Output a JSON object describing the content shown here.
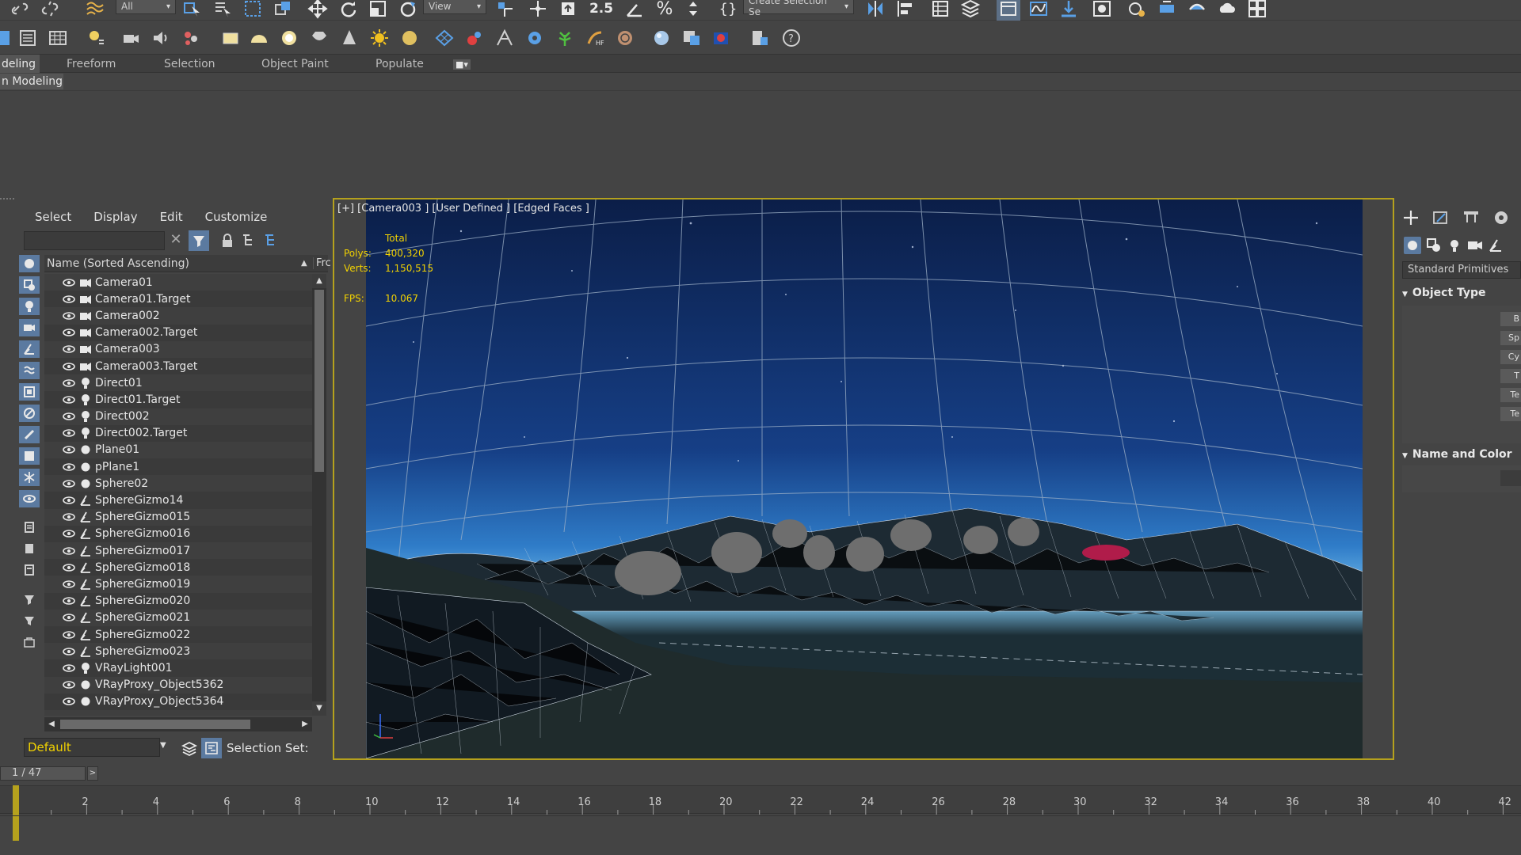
{
  "toolbar": {
    "selection_filter": "All",
    "reference_coord": "View",
    "named_selection": "Create Selection Se",
    "snap_label": "2.5"
  },
  "ribbon": {
    "tabs": [
      "deling",
      "Freeform",
      "Selection",
      "Object Paint",
      "Populate"
    ],
    "sub_label": "n Modeling"
  },
  "scene_explorer": {
    "menu": [
      "Select",
      "Display",
      "Edit",
      "Customize"
    ],
    "column_header": "Name (Sorted Ascending)",
    "column_header2": "Frc",
    "objects": [
      {
        "name": "Camera01",
        "type": "camera-icon"
      },
      {
        "name": "Camera01.Target",
        "type": "camera-icon"
      },
      {
        "name": "Camera002",
        "type": "camera-icon"
      },
      {
        "name": "Camera002.Target",
        "type": "camera-icon"
      },
      {
        "name": "Camera003",
        "type": "camera-icon"
      },
      {
        "name": "Camera003.Target",
        "type": "camera-icon"
      },
      {
        "name": "Direct01",
        "type": "light-icon"
      },
      {
        "name": "Direct01.Target",
        "type": "light-icon"
      },
      {
        "name": "Direct002",
        "type": "light-icon"
      },
      {
        "name": "Direct002.Target",
        "type": "light-icon"
      },
      {
        "name": "Plane01",
        "type": "geometry-icon"
      },
      {
        "name": "pPlane1",
        "type": "geometry-icon"
      },
      {
        "name": "Sphere02",
        "type": "geometry-icon"
      },
      {
        "name": "SphereGizmo14",
        "type": "helper-icon"
      },
      {
        "name": "SphereGizmo015",
        "type": "helper-icon"
      },
      {
        "name": "SphereGizmo016",
        "type": "helper-icon"
      },
      {
        "name": "SphereGizmo017",
        "type": "helper-icon"
      },
      {
        "name": "SphereGizmo018",
        "type": "helper-icon"
      },
      {
        "name": "SphereGizmo019",
        "type": "helper-icon"
      },
      {
        "name": "SphereGizmo020",
        "type": "helper-icon"
      },
      {
        "name": "SphereGizmo021",
        "type": "helper-icon"
      },
      {
        "name": "SphereGizmo022",
        "type": "helper-icon"
      },
      {
        "name": "SphereGizmo023",
        "type": "helper-icon"
      },
      {
        "name": "VRayLight001",
        "type": "light-icon"
      },
      {
        "name": "VRayProxy_Object5362",
        "type": "geometry-icon"
      },
      {
        "name": "VRayProxy_Object5364",
        "type": "geometry-icon"
      }
    ],
    "layer": "Default",
    "selection_set_label": "Selection Set:"
  },
  "viewport": {
    "label": "[+] [Camera003 ] [User Defined ] [Edged Faces ]",
    "stats_total": "Total",
    "polys_label": "Polys:",
    "polys_value": "400,320",
    "verts_label": "Verts:",
    "verts_value": "1,150,515",
    "fps_label": "FPS:",
    "fps_value": "10.067"
  },
  "command_panel": {
    "category": "Standard Primitives",
    "rollout1": "Object Type",
    "rollout2": "Name and Color",
    "buttons": [
      "B",
      "Sp",
      "Cy",
      "T",
      "Te",
      "Te"
    ]
  },
  "timeline": {
    "frame_counter": "1 / 47",
    "ticks": [
      "2",
      "4",
      "6",
      "8",
      "10",
      "12",
      "14",
      "16",
      "18",
      "20",
      "22",
      "24",
      "26",
      "28",
      "30",
      "32",
      "34",
      "36",
      "38",
      "40",
      "42"
    ]
  },
  "colors": {
    "viewport_border": "#b5a11d",
    "stats_yellow": "#f2d200",
    "highlight_blue": "#4a8fd6"
  }
}
